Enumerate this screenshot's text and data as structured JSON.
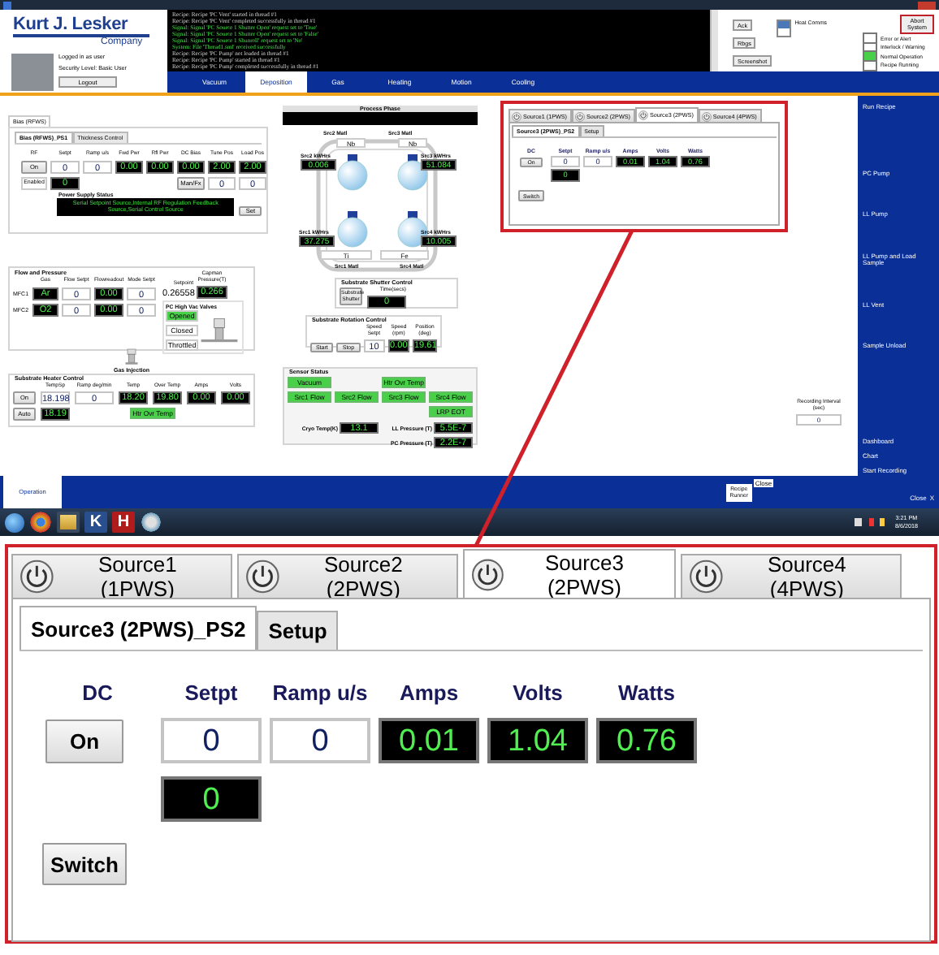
{
  "header": {
    "logo": {
      "name": "Kurt J. Lesker",
      "tagline": "Company"
    },
    "user": {
      "login_status": "Logged in as user",
      "security_level": "Security Level: Basic User",
      "logout_button": "Logout"
    },
    "log": [
      {
        "kind": "recipe",
        "text": "Recipe: Recipe 'PC Vent' started in thread #1"
      },
      {
        "kind": "recipe",
        "text": "Recipe: Recipe 'PC Vent' completed successfully in thread #1"
      },
      {
        "kind": "signal",
        "text": "Signal: Signal 'PC Source 1 Shutter Open' request set to 'True'"
      },
      {
        "kind": "signal",
        "text": "Signal: Signal 'PC Source 1 Shutter Open' request set to 'False'"
      },
      {
        "kind": "signal",
        "text": "Signal: Signal 'PC Source 1 Shunroll' request set to 'No'"
      },
      {
        "kind": "system",
        "text": "System: File 'Thread1.sml' received successfully"
      },
      {
        "kind": "recipe",
        "text": "Recipe: Recipe 'PC Pump' not loaded in thread #1"
      },
      {
        "kind": "recipe",
        "text": "Recipe: Recipe 'PC Pump' started in thread #1"
      },
      {
        "kind": "recipe",
        "text": "Recipe: Recipe 'PC Pump' completed successfully in thread #1"
      }
    ],
    "alarm_buttons": [
      "Ack",
      "Rbgs",
      "Screenshot"
    ],
    "heat_comms": {
      "label": "Heat Comms",
      "on": true
    },
    "abort_button": "Abort System",
    "legend": [
      {
        "label": "Error or Alert",
        "on": false
      },
      {
        "label": "Interlock / Warning",
        "on": false
      },
      {
        "label": "Normal Operation",
        "on": true
      },
      {
        "label": "Recipe Running",
        "on": false
      }
    ]
  },
  "tabs": [
    {
      "label": "Vacuum",
      "selected": false
    },
    {
      "label": "Deposition",
      "selected": true
    },
    {
      "label": "Gas",
      "selected": false
    },
    {
      "label": "Heating",
      "selected": false
    },
    {
      "label": "Motion",
      "selected": false
    },
    {
      "label": "Cooling",
      "selected": false
    }
  ],
  "bias_panel": {
    "title": "Bias (RFWS)",
    "tabs": [
      {
        "label": "Bias (RFWS)_PS1",
        "selected": true
      },
      {
        "label": "Thickness Control",
        "selected": false
      }
    ],
    "columns": [
      "RF",
      "Setpt",
      "Ramp u/s",
      "Fwd Pwr",
      "Rfl Pwr",
      "DC Bias",
      "Tune Pos",
      "Load Pos"
    ],
    "row1": [
      {
        "kind": "button",
        "value": "On"
      },
      {
        "kind": "input",
        "value": "0"
      },
      {
        "kind": "input",
        "value": "0"
      },
      {
        "kind": "readout",
        "value": "0.00"
      },
      {
        "kind": "readout",
        "value": "0.00"
      },
      {
        "kind": "readout",
        "value": "0.00"
      },
      {
        "kind": "readout",
        "value": "2.00"
      },
      {
        "kind": "readout",
        "value": "2.00"
      }
    ],
    "row2": [
      {
        "kind": "status",
        "value": "Enabled"
      },
      {
        "kind": "readout",
        "value": "0"
      },
      {
        "kind": "blank"
      },
      {
        "kind": "blank"
      },
      {
        "kind": "blank"
      },
      {
        "kind": "button",
        "value": "Man/Fx"
      },
      {
        "kind": "input",
        "value": "0"
      },
      {
        "kind": "input",
        "value": "0"
      }
    ],
    "status_label": "Power Supply Status",
    "status_text": "Serial Setpoint Source,Internal RF Regulation Feedback Source,Serial Control Source",
    "set_button": "Set"
  },
  "flow_panel": {
    "title": "Flow and Pressure",
    "columns": [
      "Gas",
      "Flow Setpt",
      "Flowreadout",
      "Mode Setpt"
    ],
    "rows": [
      {
        "label": "MFC1",
        "cells": [
          {
            "kind": "readout",
            "value": "Ar"
          },
          {
            "kind": "input",
            "value": "0"
          },
          {
            "kind": "readout",
            "value": "0.00"
          },
          {
            "kind": "input",
            "value": "0"
          }
        ]
      },
      {
        "label": "MFC2",
        "cells": [
          {
            "kind": "readout",
            "value": "O2"
          },
          {
            "kind": "input",
            "value": "0"
          },
          {
            "kind": "readout",
            "value": "0.00"
          },
          {
            "kind": "input",
            "value": "0"
          }
        ]
      }
    ],
    "setpoint": {
      "label": "Setpoint",
      "value": "0.26558"
    },
    "capman": {
      "label": "Capman Pressure(T)",
      "value": "0.266"
    },
    "valves": {
      "title": "PC High Vac Valves",
      "options": [
        {
          "label": "Opened",
          "selected": true
        },
        {
          "label": "Closed",
          "selected": false
        },
        {
          "label": "Throttled",
          "selected": false
        }
      ]
    },
    "gas_injection_label": "Gas Injection"
  },
  "heater_panel": {
    "title": "Substrate Heater Control",
    "columns": [
      "TempSp",
      "Ramp deg/min",
      "Temp",
      "Over Temp",
      "Amps",
      "Volts"
    ],
    "row1": [
      {
        "kind": "button",
        "value": "On"
      },
      {
        "kind": "input",
        "value": "18.198"
      },
      {
        "kind": "input",
        "value": "0"
      },
      {
        "kind": "readout",
        "value": "18.20"
      },
      {
        "kind": "readout",
        "value": "19.80"
      },
      {
        "kind": "readout",
        "value": "0.00"
      },
      {
        "kind": "readout",
        "value": "0.00"
      }
    ],
    "row2": [
      {
        "kind": "button",
        "value": "Auto"
      },
      {
        "kind": "readout",
        "value": "18.19"
      }
    ],
    "indicator": {
      "label": "Htr Ovr Temp",
      "on": true
    }
  },
  "process": {
    "title": "Process Phase",
    "sources": [
      {
        "matl_label": "Src2 Matl",
        "matl": "Nb",
        "kwh_label": "Src2 kWHrs",
        "kwh": "0.006"
      },
      {
        "matl_label": "Src3 Matl",
        "matl": "Nb",
        "kwh_label": "Src3 kWHrs",
        "kwh": "51.084"
      },
      {
        "matl_label": "Src1 Matl",
        "matl": "Ti",
        "kwh_label": "Src1 kWHrs",
        "kwh": "37.275"
      },
      {
        "matl_label": "Src4 Matl",
        "matl": "Fe",
        "kwh_label": "Src4 kWHrs",
        "kwh": "10.005"
      }
    ]
  },
  "shutter_panel": {
    "title": "Substrate Shutter Control",
    "button": "Substrate Shutter",
    "time_label": "Time(secs)",
    "time": "0"
  },
  "rotation_panel": {
    "title": "Substrate Rotation Control",
    "buttons": [
      "Start",
      "Stop"
    ],
    "fields": [
      {
        "label": "Speed Setpt",
        "kind": "input",
        "value": "10"
      },
      {
        "label": "Speed (rpm)",
        "kind": "readout",
        "value": "0.00"
      },
      {
        "label": "Position (deg)",
        "kind": "readout",
        "value": "19.61"
      }
    ]
  },
  "sensor_panel": {
    "title": "Sensor Status",
    "indicators": [
      {
        "kind": "indicator",
        "label": "Vacuum",
        "on": true
      },
      {
        "kind": "blank"
      },
      {
        "kind": "indicator",
        "label": "Htr Ovr Temp",
        "on": true
      },
      {
        "kind": "blank"
      },
      {
        "kind": "indicator",
        "label": "Src1 Flow",
        "on": true
      },
      {
        "kind": "indicator",
        "label": "Src2 Flow",
        "on": true
      },
      {
        "kind": "indicator",
        "label": "Src3 Flow",
        "on": true
      },
      {
        "kind": "indicator",
        "label": "Src4 Flow",
        "on": true
      },
      {
        "kind": "blank"
      },
      {
        "kind": "blank"
      },
      {
        "kind": "blank"
      },
      {
        "kind": "indicator",
        "label": "LRP EOT",
        "on": true
      }
    ],
    "readings": [
      {
        "label": "Cryo Temp(K)",
        "value": "13.1"
      },
      {
        "label": "LL Pressure (T)",
        "value": "5.5E-7"
      },
      {
        "label": "PC Pressure (T)",
        "value": "2.2E-7"
      }
    ]
  },
  "source_panel": {
    "tabs": [
      {
        "label": "Source1 (1PWS)",
        "selected": false
      },
      {
        "label": "Source2 (2PWS)",
        "selected": false
      },
      {
        "label": "Source3 (2PWS)",
        "selected": true
      },
      {
        "label": "Source4 (4PWS)",
        "selected": false
      }
    ],
    "subtabs": [
      {
        "label": "Source3 (2PWS)_PS2",
        "selected": true
      },
      {
        "label": "Setup",
        "selected": false
      }
    ],
    "columns": [
      "DC",
      "Setpt",
      "Ramp u/s",
      "Amps",
      "Volts",
      "Watts"
    ],
    "row1": [
      {
        "kind": "button",
        "value": "On"
      },
      {
        "kind": "input",
        "value": "0"
      },
      {
        "kind": "input",
        "value": "0"
      },
      {
        "kind": "readout",
        "value": "0.01"
      },
      {
        "kind": "readout",
        "value": "1.04"
      },
      {
        "kind": "readout",
        "value": "0.76"
      }
    ],
    "row2": [
      {
        "kind": "blank"
      },
      {
        "kind": "readout",
        "value": "0"
      }
    ],
    "switch_button": "Switch"
  },
  "recording": {
    "label": "Recording Interval (sec)",
    "value": "0"
  },
  "sidebar": {
    "actions": [
      "Run Recipe",
      "PC Pump",
      "LL Pump",
      "LL Pump and Load Sample",
      "LL Vent",
      "Sample Unload"
    ],
    "links": [
      "Dashboard",
      "Chart",
      "Start Recording"
    ]
  },
  "bottom_bar": {
    "tabs": [
      {
        "label": "Operation",
        "selected": true
      }
    ],
    "recipe_runner": "Recipe Runner",
    "close_small": "Close",
    "close": "Close",
    "close_x": "X"
  },
  "taskbar": {
    "apps": [
      {
        "kind": "start"
      },
      {
        "kind": "browser"
      },
      {
        "kind": "folder"
      },
      {
        "kind": "letter",
        "label": "K",
        "color": "#2a4f8f"
      },
      {
        "kind": "letter",
        "label": "H",
        "color": "#b01c1c"
      },
      {
        "kind": "globe"
      }
    ],
    "time": "3:21 PM",
    "date": "8/6/2018"
  },
  "zoom_inset": {
    "tabs": [
      {
        "label": "Source1 (1PWS)",
        "selected": false
      },
      {
        "label": "Source2 (2PWS)",
        "selected": false
      },
      {
        "label": "Source3 (2PWS)",
        "selected": true
      },
      {
        "label": "Source4 (4PWS)",
        "selected": false
      }
    ],
    "subtabs": [
      {
        "label": "Source3 (2PWS)_PS2",
        "selected": true
      },
      {
        "label": "Setup",
        "selected": false
      }
    ],
    "columns": [
      "DC",
      "Setpt",
      "Ramp u/s",
      "Amps",
      "Volts",
      "Watts"
    ],
    "row1": [
      {
        "kind": "button",
        "value": "On"
      },
      {
        "kind": "input",
        "value": "0"
      },
      {
        "kind": "input",
        "value": "0"
      },
      {
        "kind": "readout",
        "value": "0.01"
      },
      {
        "kind": "readout",
        "value": "1.04"
      },
      {
        "kind": "readout",
        "value": "0.76"
      }
    ],
    "row2": [
      {
        "kind": "blank"
      },
      {
        "kind": "readout",
        "value": "0"
      }
    ],
    "switch_button": "Switch"
  }
}
